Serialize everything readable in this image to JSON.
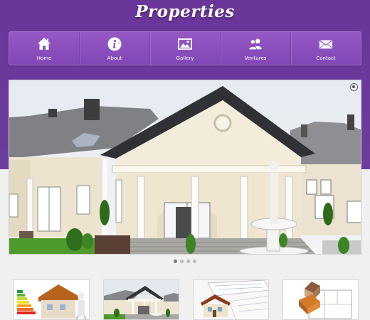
{
  "site": {
    "title": "Properties"
  },
  "nav": {
    "items": [
      {
        "label": "Home",
        "icon": "home-icon"
      },
      {
        "label": "About",
        "icon": "info-icon"
      },
      {
        "label": "Gallery",
        "icon": "image-icon"
      },
      {
        "label": "Ventures",
        "icon": "users-icon"
      },
      {
        "label": "Contact",
        "icon": "mail-icon"
      }
    ]
  },
  "slider": {
    "slide_count": 4,
    "active_slide": 1,
    "controls": {
      "pause_icon": "pause-circle-icon"
    }
  },
  "thumbnails": [
    {
      "icon": "energy-rating-house-image"
    },
    {
      "icon": "mansion-photo-image"
    },
    {
      "icon": "blueprint-house-image"
    },
    {
      "icon": "floorplan-image"
    }
  ],
  "colors": {
    "header_purple": "#6b3a9c",
    "nav_purple": "#8a4dbc",
    "text_white": "#ffffff",
    "page_bg": "#f0f0f0"
  }
}
